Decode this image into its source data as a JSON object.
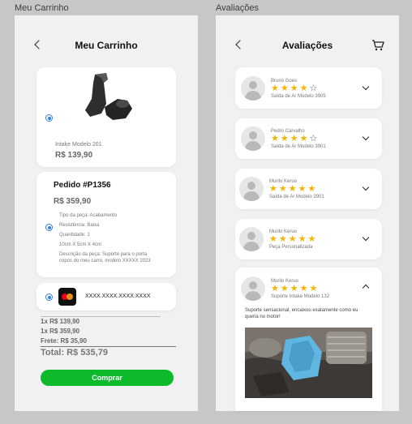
{
  "labels": {
    "cart_frame": "Meu Carrinho",
    "reviews_frame": "Avaliações"
  },
  "cart": {
    "title": "Meu Carrinho",
    "product": {
      "name": "Intake Modelo 201",
      "price": "R$ 139,90"
    },
    "order": {
      "title": "Pedido #P1356",
      "price": "R$ 359,90",
      "details": [
        "Tipo da peça: Acabamento",
        "Resistência: Baixa",
        "Quantidade: 1",
        "10cm X 5cm X 4cm",
        "Descrição da peça: Suporte para o porta copos do meu carro, modelo XXXXX 2023"
      ]
    },
    "payment": {
      "card_number": "XXXX.XXXX.XXXX.XXXX"
    },
    "summary": [
      "1x R$ 139,90",
      "1x R$ 359,90",
      "Frete: R$ 35,90"
    ],
    "total": "Total: R$ 535,79",
    "buy_label": "Comprar"
  },
  "reviews": {
    "title": "Avaliações",
    "items": [
      {
        "name": "Bruno Goes",
        "product": "Saída de Ar Modelo 3905",
        "rating": 4
      },
      {
        "name": "Pedro Carvalho",
        "product": "Saída de Ar Modelo 3901",
        "rating": 4
      },
      {
        "name": "Murilo Keruo",
        "product": "Saída de Ar Modelo 3901",
        "rating": 5
      },
      {
        "name": "Murilo Keruo",
        "product": "Peça Personalizada",
        "rating": 5
      },
      {
        "name": "Murilo Keruo",
        "product": "Suporte Intake Modelo 132",
        "rating": 5,
        "comment": "Suporte sensacional, encaixou exatamente como eu queria no motor!"
      }
    ]
  },
  "colors": {
    "accent_blue": "#2e7fe0",
    "star": "#f5b400",
    "buy_green": "#0dbb2a"
  }
}
